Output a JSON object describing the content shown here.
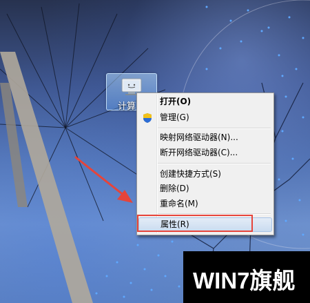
{
  "desktop": {
    "icon": {
      "label": "计算",
      "icon_name": "computer-icon"
    }
  },
  "context_menu": {
    "items": [
      {
        "label": "打开(O)",
        "bold": true
      },
      {
        "label": "管理(G)",
        "icon": "uac-shield-icon"
      },
      {
        "label": "映射网络驱动器(N)..."
      },
      {
        "label": "断开网络驱动器(C)..."
      },
      {
        "label": "创建快捷方式(S)"
      },
      {
        "label": "删除(D)"
      },
      {
        "label": "重命名(M)"
      },
      {
        "label": "属性(R)",
        "highlighted": true
      }
    ]
  },
  "annotation": {
    "highlight_color": "#e6443a",
    "arrow_color": "#e6443a"
  },
  "watermark": {
    "text": "WIN7旗舰"
  }
}
